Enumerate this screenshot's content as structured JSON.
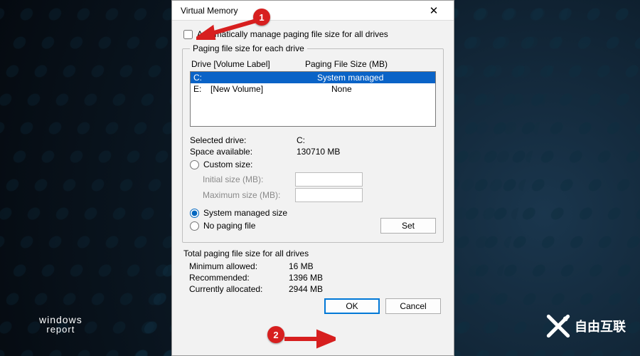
{
  "window": {
    "title": "Virtual Memory",
    "close_glyph": "✕"
  },
  "auto_manage": {
    "label": "Automatically manage paging file size for all drives",
    "checked": false
  },
  "drive_group": {
    "legend": "Paging file size for each drive",
    "header_drive": "Drive  [Volume Label]",
    "header_size": "Paging File Size (MB)",
    "rows": [
      {
        "drive": "C:",
        "label": "",
        "size": "System managed",
        "selected": true
      },
      {
        "drive": "E:",
        "label": "[New Volume]",
        "size": "None",
        "selected": false
      }
    ],
    "selected_drive_label": "Selected drive:",
    "selected_drive_value": "C:",
    "space_available_label": "Space available:",
    "space_available_value": "130710 MB",
    "custom_size_label": "Custom size:",
    "initial_label": "Initial size (MB):",
    "maximum_label": "Maximum size (MB):",
    "system_managed_label": "System managed size",
    "no_paging_label": "No paging file",
    "set_button": "Set",
    "size_mode": "system"
  },
  "totals": {
    "heading": "Total paging file size for all drives",
    "min_label": "Minimum allowed:",
    "min_value": "16 MB",
    "rec_label": "Recommended:",
    "rec_value": "1396 MB",
    "cur_label": "Currently allocated:",
    "cur_value": "2944 MB"
  },
  "buttons": {
    "ok": "OK",
    "cancel": "Cancel"
  },
  "annotations": {
    "badge1": "1",
    "badge2": "2"
  },
  "page_logo": {
    "line1": "windows",
    "line2": "report"
  },
  "watermark": "自由互联"
}
